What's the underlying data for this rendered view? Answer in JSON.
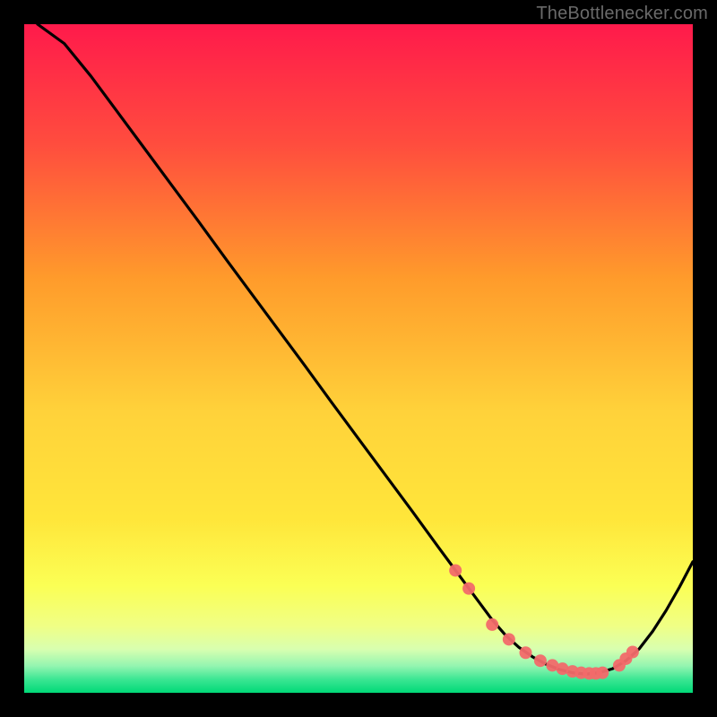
{
  "attribution": "TheBottlenecker.com",
  "chart_data": {
    "type": "line",
    "title": "",
    "xlabel": "",
    "ylabel": "",
    "xlim": [
      0,
      100
    ],
    "ylim": [
      0,
      100
    ],
    "background_gradient": {
      "top": "#ff1a4b",
      "mid_upper": "#ff9b2b",
      "mid": "#ffe63a",
      "mid_lower": "#f5ff6e",
      "band": "#d8ffb0",
      "bottom": "#00d977"
    },
    "series": [
      {
        "name": "curve",
        "x": [
          2,
          6,
          10,
          14,
          18,
          22,
          26,
          30,
          34,
          38,
          42,
          46,
          50,
          54,
          58,
          62,
          64,
          66,
          68,
          70,
          72,
          74,
          76,
          78,
          80,
          82,
          84,
          86,
          88,
          90,
          92,
          94,
          96,
          98,
          100
        ],
        "y": [
          100,
          97.1,
          92.2,
          86.8,
          81.4,
          76.0,
          70.6,
          65.1,
          59.7,
          54.3,
          48.9,
          43.4,
          38.0,
          32.6,
          27.2,
          21.7,
          19.0,
          16.3,
          13.6,
          10.9,
          8.6,
          6.8,
          5.4,
          4.3,
          3.5,
          3.0,
          2.8,
          3.0,
          3.6,
          4.8,
          6.6,
          9.2,
          12.3,
          15.8,
          19.6
        ]
      }
    ],
    "markers": {
      "name": "dots",
      "x": [
        64.5,
        66.5,
        70.0,
        72.5,
        75.0,
        77.2,
        79.0,
        80.5,
        82.0,
        83.3,
        84.5,
        85.5,
        86.5,
        89.0,
        90.0,
        91.0
      ],
      "y": [
        18.3,
        15.6,
        10.2,
        8.0,
        6.0,
        4.8,
        4.1,
        3.6,
        3.2,
        3.0,
        2.9,
        2.9,
        3.0,
        4.1,
        5.1,
        6.1
      ],
      "color": "#f26a6a",
      "radius": 7
    }
  }
}
